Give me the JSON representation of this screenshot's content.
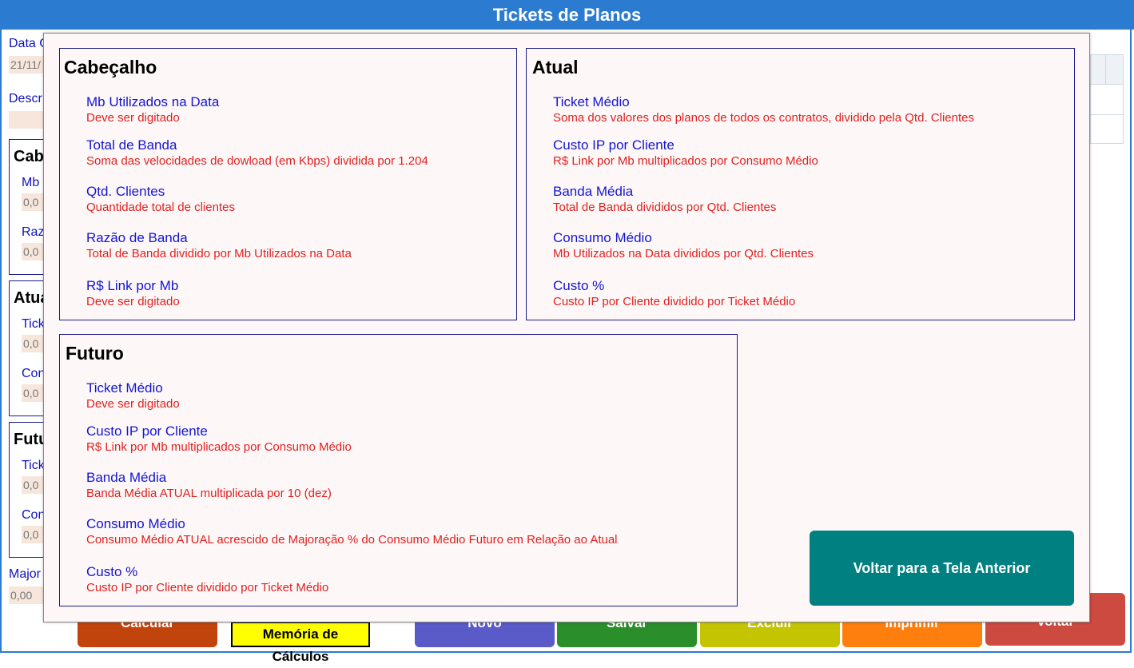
{
  "window": {
    "title": "Tickets de Planos"
  },
  "background_form": {
    "date_label": "Data C",
    "date_value": "21/11/",
    "desc_label": "Descr",
    "groups": [
      {
        "title": "Cabe",
        "fields": [
          {
            "label": "Mb",
            "value": "0,0"
          },
          {
            "label": "Raz",
            "value": "0,0"
          }
        ]
      },
      {
        "title": "Atua",
        "fields": [
          {
            "label": "Tick",
            "value": "0,0"
          },
          {
            "label": "Con",
            "value": "0,0"
          }
        ]
      },
      {
        "title": "Futu",
        "fields": [
          {
            "label": "Tick",
            "value": "0,0"
          },
          {
            "label": "Con",
            "value": "0,0"
          }
        ]
      }
    ],
    "major_label": "Major",
    "major_value": "0,00",
    "buttons": {
      "calcular": "Calcular",
      "memoria": "Memória de Cálculos",
      "novo": "Novo",
      "salvar": "Salvar",
      "excluir": "Excluir",
      "imprimir": "Imprimir",
      "voltar": "Voltar"
    },
    "colors": {
      "calcular": "#c0440c",
      "novo": "#5a5ac8",
      "salvar": "#2a8f2a",
      "excluir": "#c4c400",
      "imprimir": "#ff7f0e",
      "voltar": "#cc4a40"
    }
  },
  "modal": {
    "cabecalho": {
      "title": "Cabeçalho",
      "items": [
        {
          "name": "Mb Utilizados na Data",
          "desc": "Deve ser digitado"
        },
        {
          "name": "Total de Banda",
          "desc": "Soma das velocidades de dowload (em Kbps) dividida por 1.204"
        },
        {
          "name": "Qtd. Clientes",
          "desc": "Quantidade total de clientes"
        },
        {
          "name": "Razão de Banda",
          "desc": "Total de Banda dividido por Mb Utilizados na Data"
        },
        {
          "name": "R$ Link por Mb",
          "desc": "Deve ser digitado"
        }
      ]
    },
    "atual": {
      "title": "Atual",
      "items": [
        {
          "name": "Ticket Médio",
          "desc": "Soma dos valores dos planos de todos os contratos, dividido pela Qtd. Clientes"
        },
        {
          "name": "Custo IP por Cliente",
          "desc": "R$ Link por Mb multiplicados por Consumo Médio"
        },
        {
          "name": "Banda Média",
          "desc": "Total de Banda divididos por Qtd. Clientes"
        },
        {
          "name": "Consumo Médio",
          "desc": "Mb Utilizados na Data divididos por Qtd. Clientes"
        },
        {
          "name": "Custo %",
          "desc": "Custo IP por Cliente dividido por Ticket Médio"
        }
      ]
    },
    "futuro": {
      "title": "Futuro",
      "items": [
        {
          "name": "Ticket Médio",
          "desc": "Deve ser digitado"
        },
        {
          "name": "Custo IP por Cliente",
          "desc": "R$ Link por Mb multiplicados por Consumo Médio"
        },
        {
          "name": "Banda Média",
          "desc": "Banda Média ATUAL multiplicada por 10 (dez)"
        },
        {
          "name": "Consumo Médio",
          "desc": "Consumo Médio ATUAL acrescido de Majoração % do Consumo Médio Futuro em Relação ao Atual"
        },
        {
          "name": "Custo %",
          "desc": "Custo IP por Cliente dividido por Ticket Médio"
        }
      ]
    },
    "back_button": "Voltar para a Tela Anterior",
    "colors": {
      "accent": "#008080",
      "name_text": "#1515d0",
      "desc_text": "#e02020"
    }
  }
}
